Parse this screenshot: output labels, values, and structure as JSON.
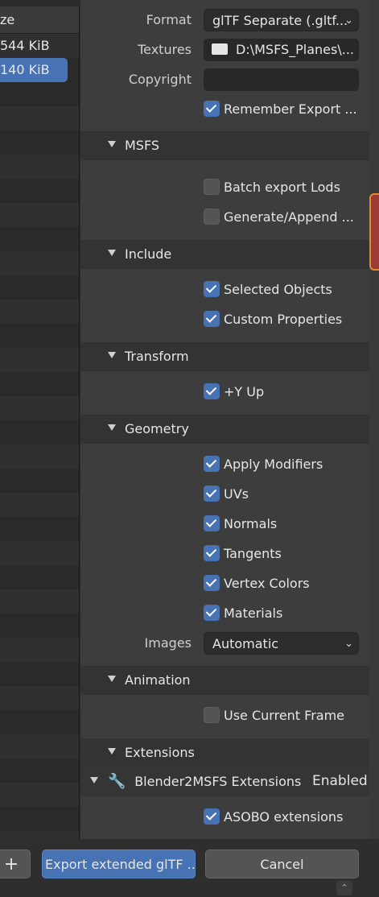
{
  "file_list": {
    "header": "ze",
    "rows": [
      {
        "size": "544 KiB",
        "selected": false
      },
      {
        "size": "140 KiB",
        "selected": true
      }
    ]
  },
  "settings": {
    "format_label": "Format",
    "format_value": "glTF Separate (.gltf...",
    "textures_label": "Textures",
    "textures_value": "D:\\MSFS_Planes\\...",
    "copyright_label": "Copyright",
    "copyright_value": "",
    "remember_export": "Remember Export ..."
  },
  "sections": {
    "msfs": "MSFS",
    "include": "Include",
    "transform": "Transform",
    "geometry": "Geometry",
    "animation": "Animation",
    "extensions": "Extensions"
  },
  "msfs": {
    "batch_export_lods": "Batch export Lods",
    "generate_append": "Generate/Append ..."
  },
  "include": {
    "selected_objects": "Selected Objects",
    "custom_properties": "Custom Properties"
  },
  "transform": {
    "y_up": "+Y Up"
  },
  "geometry": {
    "apply_modifiers": "Apply Modifiers",
    "uvs": "UVs",
    "normals": "Normals",
    "tangents": "Tangents",
    "vertex_colors": "Vertex Colors",
    "materials": "Materials",
    "images_label": "Images",
    "images_value": "Automatic"
  },
  "animation": {
    "use_current_frame": "Use Current Frame"
  },
  "extensions": {
    "subpanel_title": "Blender2MSFS Extensions",
    "enabled_label": "Enabled",
    "asobo_extensions": "ASOBO extensions"
  },
  "bottom": {
    "plus": "+",
    "export_button": "Export extended glTF ...",
    "cancel_button": "Cancel"
  },
  "colors": {
    "accent": "#4772b3",
    "panel": "#3d3d3d",
    "section_header": "#333333"
  }
}
